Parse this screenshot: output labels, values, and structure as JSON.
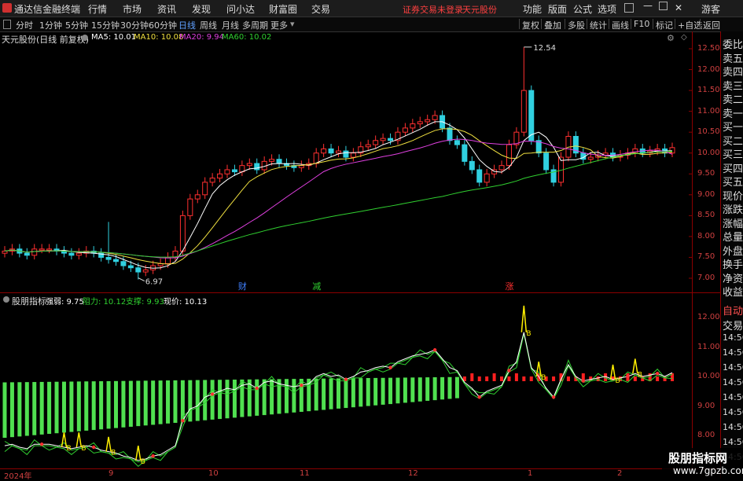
{
  "menubar": {
    "app_title": "通达信金融终端",
    "menus": [
      "行情",
      "市场",
      "资讯",
      "发现",
      "问小达",
      "财富圈",
      "交易"
    ],
    "notice": "证券交易未登录",
    "stock_name": "天元股份",
    "right_menus": [
      "功能",
      "版面",
      "公式",
      "选项"
    ],
    "user": "游客"
  },
  "periods": [
    "分时",
    "1分钟",
    "5分钟",
    "15分钟",
    "30分钟",
    "60分钟",
    "日线",
    "周线",
    "月线",
    "多周期",
    "更多"
  ],
  "active_period": "日线",
  "toolbar": [
    "复权",
    "叠加",
    "多股",
    "统计",
    "画线",
    "F10",
    "标记",
    "+自选",
    "返回"
  ],
  "main_chart": {
    "title": "天元股份(日线 前复权)",
    "ma": [
      {
        "label": "MA5: 10.01",
        "color": "#ffffff"
      },
      {
        "label": "MA10: 10.08",
        "color": "#f0e040"
      },
      {
        "label": "MA20: 9.94",
        "color": "#e040e0"
      },
      {
        "label": "MA60: 10.02",
        "color": "#30d030"
      }
    ],
    "high_label": "12.54",
    "low_label": "6.97",
    "event_marks": [
      {
        "text": "财",
        "color": "#4080ff"
      },
      {
        "text": "减",
        "color": "#30d030"
      },
      {
        "text": "涨",
        "color": "#ff3030"
      }
    ]
  },
  "indicator": {
    "title": "股朋指标",
    "items": [
      {
        "label": "强弱: 9.75",
        "color": "#ffffff"
      },
      {
        "label": "阻力: 10.12",
        "color": "#30d030"
      },
      {
        "label": "支撑: 9.93",
        "color": "#30d030"
      },
      {
        "label": "现价: 10.13",
        "color": "#ffffff"
      }
    ],
    "marker": "B"
  },
  "price_axis": [
    "12.50",
    "12.00",
    "11.50",
    "11.00",
    "10.50",
    "10.00",
    "9.50",
    "9.00",
    "8.50",
    "8.00",
    "7.50",
    "7.00"
  ],
  "ind_axis": [
    "12.00",
    "11.00",
    "10.00",
    "9.00",
    "8.00"
  ],
  "date_axis": [
    "2024年",
    "9",
    "10",
    "11",
    "12",
    "1",
    "2"
  ],
  "sidebar_quote": [
    "委比",
    "卖五",
    "卖四",
    "卖三",
    "卖二",
    "卖一",
    "买一",
    "买二",
    "买三",
    "买四",
    "买五",
    "现价",
    "涨跌",
    "涨幅",
    "总量",
    "外盘",
    "换手",
    "净资",
    "收益"
  ],
  "sidebar_trade": [
    "自动",
    "交易",
    "14:56",
    "14:56",
    "14:56",
    "14:56",
    "14:56",
    "14:56",
    "14:56",
    "14:56",
    "14:56"
  ],
  "watermark": {
    "text": "股朋指标网",
    "url": "www.7gpzb.com"
  },
  "colors": {
    "up": "#ff3030",
    "down": "#30d0e0",
    "accent_red": "#d04040"
  },
  "chart_data": {
    "type": "candlestick",
    "title": "天元股份(日线 前复权)",
    "x_range": [
      "2024-08",
      "2025-02"
    ],
    "ylim": [
      6.8,
      12.8
    ],
    "ticks_y": [
      7.0,
      7.5,
      8.0,
      8.5,
      9.0,
      9.5,
      10.0,
      10.5,
      11.0,
      11.5,
      12.0,
      12.5
    ],
    "ohlc_close_approx": [
      7.65,
      7.7,
      7.6,
      7.55,
      7.7,
      7.7,
      7.7,
      7.65,
      7.6,
      7.55,
      7.6,
      7.65,
      7.6,
      7.5,
      7.45,
      7.4,
      7.3,
      7.25,
      7.15,
      7.2,
      7.3,
      7.35,
      7.5,
      7.65,
      8.5,
      8.9,
      9.0,
      9.3,
      9.4,
      9.5,
      9.6,
      9.55,
      9.7,
      9.75,
      9.6,
      9.8,
      9.85,
      9.75,
      9.7,
      9.65,
      9.7,
      9.75,
      10.0,
      10.1,
      10.0,
      10.05,
      9.9,
      10.0,
      10.15,
      10.2,
      10.3,
      10.35,
      10.3,
      10.5,
      10.6,
      10.7,
      10.75,
      10.8,
      10.9,
      10.6,
      10.3,
      10.2,
      9.8,
      9.6,
      9.3,
      9.5,
      9.6,
      9.7,
      10.2,
      10.5,
      11.5,
      10.3,
      10.0,
      9.6,
      9.3,
      9.9,
      10.4,
      10.0,
      9.85,
      9.9,
      9.95,
      10.0,
      9.9,
      9.95,
      10.0,
      10.1,
      10.0,
      10.05,
      10.1,
      10.0,
      10.13
    ],
    "high": 12.54,
    "low": 6.97,
    "series": [
      {
        "name": "MA5",
        "last": 10.01
      },
      {
        "name": "MA10",
        "last": 10.08
      },
      {
        "name": "MA20",
        "last": 9.94
      },
      {
        "name": "MA60",
        "last": 10.02
      }
    ],
    "indicator_last": {
      "强弱": 9.75,
      "阻力": 10.12,
      "支撑": 9.93,
      "现价": 10.13
    }
  }
}
